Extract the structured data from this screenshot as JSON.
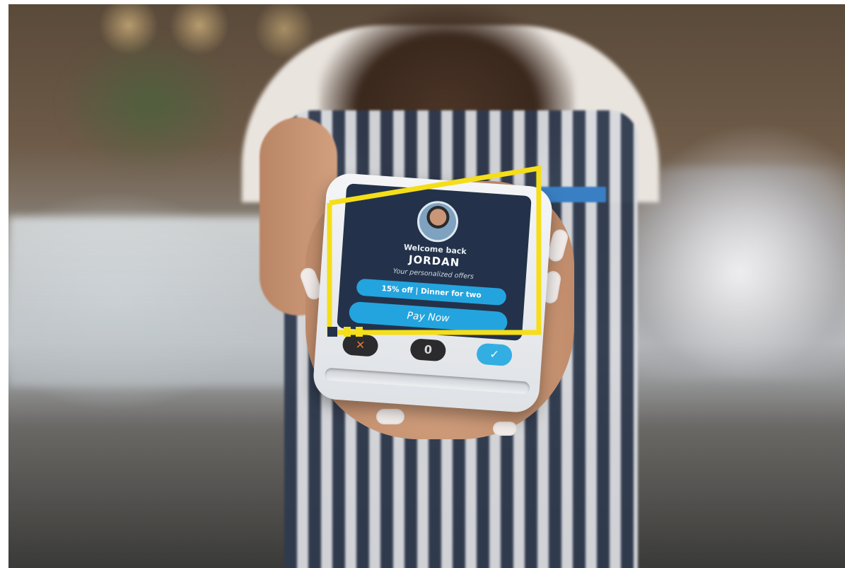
{
  "screen": {
    "welcome": "Welcome back",
    "name": "JORDAN",
    "offers_title": "Your personalized offers",
    "offer": "15% off | Dinner for two",
    "pay_button": "Pay Now"
  },
  "keypad": {
    "cancel_symbol": "✕",
    "clear_symbol": "0",
    "ok_symbol": "✓"
  },
  "colors": {
    "accent": "#23a4de",
    "screen_background": "#23324a",
    "frame_highlight": "#f5de19"
  },
  "icons": [
    "avatar",
    "cancel-key-icon",
    "clear-key-icon",
    "confirm-key-icon"
  ]
}
